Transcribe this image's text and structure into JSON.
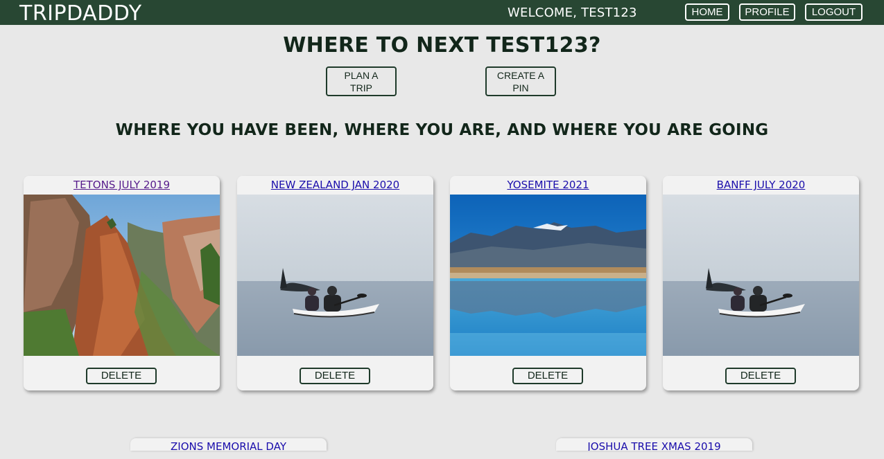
{
  "header": {
    "brand": "TRIPDADDY",
    "welcome": "WELCOME, TEST123",
    "nav": {
      "home": "HOME",
      "profile": "PROFILE",
      "logout": "LOGOUT"
    }
  },
  "main": {
    "headline": "WHERE TO NEXT TEST123?",
    "actions": {
      "plan_trip": "PLAN A TRIP",
      "create_pin": "CREATE A PIN"
    },
    "subheadline": "WHERE YOU HAVE BEEN, WHERE YOU ARE, AND WHERE YOU ARE GOING"
  },
  "trips": [
    {
      "title": "TETONS JULY 2019",
      "delete_label": "DELETE",
      "photo": "canyon-cliffs"
    },
    {
      "title": "NEW ZEALAND JAN 2020",
      "delete_label": "DELETE",
      "photo": "kayak-orca"
    },
    {
      "title": "YOSEMITE 2021",
      "delete_label": "DELETE",
      "photo": "mountain-lake-reflection"
    },
    {
      "title": "BANFF JULY 2020",
      "delete_label": "DELETE",
      "photo": "kayak-orca"
    },
    {
      "title": "ZIONS MEMORIAL DAY"
    },
    {
      "title": "JOSHUA TREE XMAS 2019"
    }
  ],
  "colors": {
    "header_bg": "#284733",
    "page_bg": "#e8e8e8",
    "card_bg": "#f2f2f2",
    "link": "#1a0dab",
    "visited_link": "#551a8b"
  }
}
